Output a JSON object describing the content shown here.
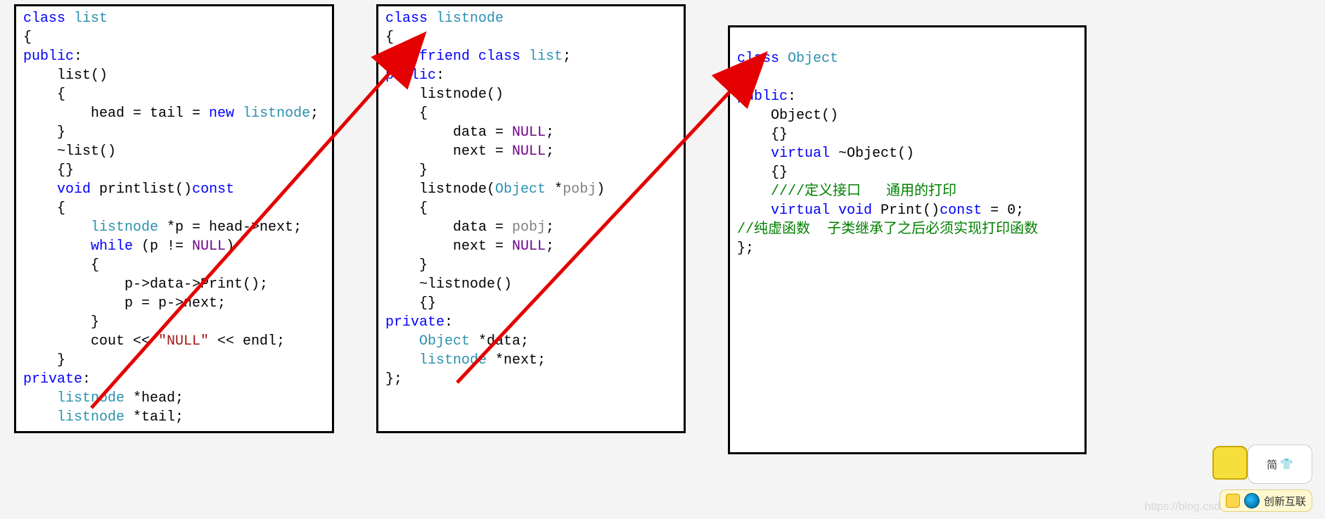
{
  "box1": {
    "l1a": "class",
    "l1b": " list",
    "l2": "{",
    "l3": "public",
    "l3b": ":",
    "l4": "    list()",
    "l5": "    {",
    "l6a": "        head = tail = ",
    "l6b": "new",
    "l6c": " listnode",
    "l6d": ";",
    "l7": "    }",
    "l8": "    ~list()",
    "l9": "    {}",
    "l10a": "    ",
    "l10b": "void",
    "l10c": " printlist()",
    "l10d": "const",
    "l11": "    {",
    "l12a": "        ",
    "l12b": "listnode",
    "l12c": " *p = head->next;",
    "l13a": "        ",
    "l13b": "while",
    "l13c": " (p != ",
    "l13d": "NULL",
    "l13e": ")",
    "l14": "        {",
    "l15": "            p->data->Print();",
    "l16": "            p = p->next;",
    "l17": "        }",
    "l18a": "        cout << ",
    "l18b": "\"NULL\"",
    "l18c": " << endl;",
    "l19": "    }",
    "l20": "private",
    "l20b": ":",
    "l21a": "    ",
    "l21b": "listnode",
    "l21c": " *head;",
    "l22a": "    ",
    "l22b": "listnode",
    "l22c": " *tail;"
  },
  "box2": {
    "l1a": "class",
    "l1b": " listnode",
    "l2": "{",
    "l3a": "    ",
    "l3b": "friend",
    "l3c": " class",
    "l3d": " list",
    "l3e": ";",
    "l4": "public",
    "l4b": ":",
    "l5": "    listnode()",
    "l6": "    {",
    "l7a": "        data = ",
    "l7b": "NULL",
    "l7c": ";",
    "l8a": "        next = ",
    "l8b": "NULL",
    "l8c": ";",
    "l9": "    }",
    "l10a": "    listnode(",
    "l10b": "Object",
    "l10c": " *",
    "l10d": "pobj",
    "l10e": ")",
    "l11": "    {",
    "l12a": "        data = ",
    "l12b": "pobj",
    "l12c": ";",
    "l13a": "        next = ",
    "l13b": "NULL",
    "l13c": ";",
    "l14": "    }",
    "l15": "    ~listnode()",
    "l16": "    {}",
    "l17": "private",
    "l17b": ":",
    "l18a": "    ",
    "l18b": "Object",
    "l18c": " *data;",
    "l19a": "    ",
    "l19b": "listnode",
    "l19c": " *next;",
    "l20": "};"
  },
  "box3": {
    "l0": "",
    "l1a": "class",
    "l1b": " Object",
    "l2": "{",
    "l3": "public",
    "l3b": ":",
    "l4": "    Object()",
    "l5": "    {}",
    "l6a": "    ",
    "l6b": "virtual",
    "l6c": " ~Object()",
    "l7": "    {}",
    "l8": "    ////定义接口   通用的打印",
    "l9a": "    ",
    "l9b": "virtual",
    "l9c": " void",
    "l9d": " Print()",
    "l9e": "const",
    "l9f": " = 0;",
    "l10": "//纯虚函数  子类继承了之后必须实现打印函数",
    "l11": "};"
  },
  "watermark": "https://blog.csdn",
  "badge_text": "创新互联",
  "avatar_text": "简"
}
